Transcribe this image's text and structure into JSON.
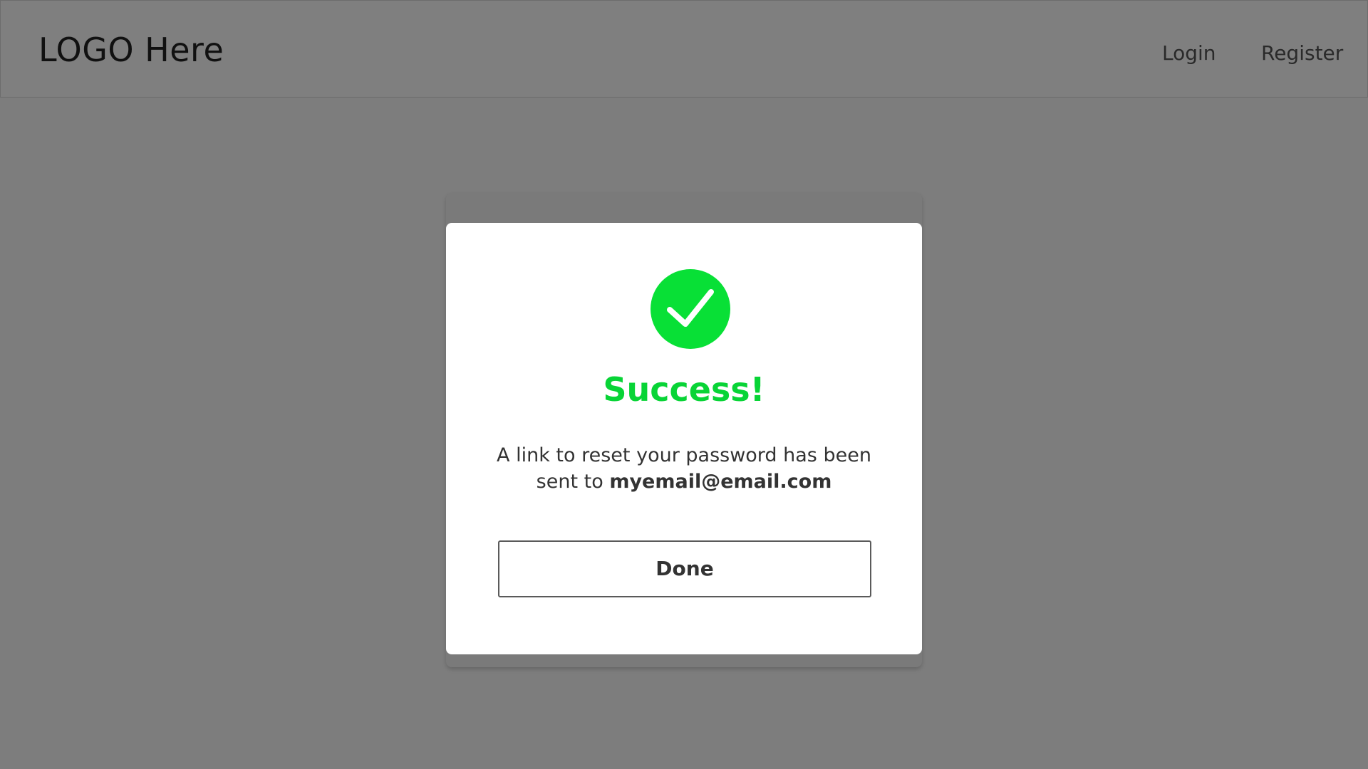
{
  "header": {
    "logo_text": "LOGO Here",
    "nav": {
      "login_label": "Login",
      "register_label": "Register"
    }
  },
  "modal": {
    "icon": "check-circle-icon",
    "title": "Success!",
    "message_prefix": "A link to reset your password has been sent to ",
    "email": "myemail@email.com",
    "done_label": "Done"
  },
  "colors": {
    "overlay": "#7d7d7d",
    "success_green": "#08e036",
    "modal_background": "#ffffff",
    "text": "#333333"
  }
}
